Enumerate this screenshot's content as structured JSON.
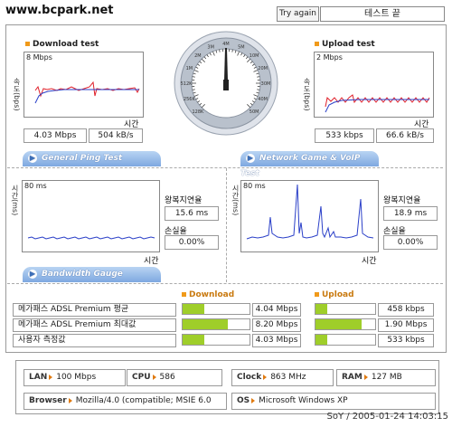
{
  "watermark": "www.bcpark.net",
  "header": {
    "try_again": "Try again",
    "status": "테스트 끝"
  },
  "download": {
    "title": "Download test",
    "scale": "8 Mbps",
    "ylabel": "속도(bps)",
    "xlabel": "시간",
    "mbps": "4.03 Mbps",
    "kbs": "504 kB/s"
  },
  "upload": {
    "title": "Upload test",
    "scale": "2 Mbps",
    "ylabel": "속도(bps)",
    "xlabel": "시간",
    "kbps": "533 kbps",
    "kbs": "66.6 kB/s"
  },
  "gauge": {
    "ticks": [
      "128K",
      "256K",
      "512K",
      "1M",
      "2M",
      "3M",
      "4M",
      "5M",
      "10M",
      "20M",
      "30M",
      "40M",
      "50M"
    ],
    "needle_mbps": 4.03
  },
  "tabs": {
    "ping": "General Ping Test",
    "game": "Network Game & VoIP Test",
    "bandwidth": "Bandwidth Gauge"
  },
  "ping": {
    "scale": "80 ms",
    "ylabel": "시간(ms)",
    "xlabel": "시간",
    "rtt_label": "왕복지연율",
    "rtt": "15.6 ms",
    "loss_label": "손실율",
    "loss": "0.00%"
  },
  "game": {
    "scale": "80 ms",
    "ylabel": "시간(ms)",
    "xlabel": "시간",
    "rtt_label": "왕복지연율",
    "rtt": "18.9 ms",
    "loss_label": "손실율",
    "loss": "0.00%"
  },
  "bandwidth": {
    "download_header": "Download",
    "upload_header": "Upload",
    "rows": [
      {
        "label": "메가패스 ADSL Premium 평균",
        "down": "4.04 Mbps",
        "down_fill": 0.33,
        "up": "458 kbps",
        "up_fill": 0.19
      },
      {
        "label": "메가패스 ADSL Premium 최대값",
        "down": "8.20 Mbps",
        "down_fill": 0.67,
        "up": "1.90 Mbps",
        "up_fill": 0.77
      },
      {
        "label": "사용자 측정값",
        "down": "4.03 Mbps",
        "down_fill": 0.33,
        "up": "533 kbps",
        "up_fill": 0.2
      }
    ]
  },
  "system": {
    "lan_label": "LAN",
    "lan": "100 Mbps",
    "cpu_label": "CPU",
    "cpu": "586",
    "clock_label": "Clock",
    "clock": "863 MHz",
    "ram_label": "RAM",
    "ram": "127 MB",
    "browser_label": "Browser",
    "browser": "Mozilla/4.0 (compatible; MSIE 6.0",
    "os_label": "OS",
    "os": "Microsoft Windows XP"
  },
  "footer": "SoY / 2005-01-24 14:03:15",
  "colors": {
    "download_line": "#e0202a",
    "upload_line": "#e0202a",
    "avg_line": "#2a3fc8",
    "bar_fill": "#9fce2a",
    "tab_blue": "#7ea8e0",
    "accent_orange": "#f09a1a"
  }
}
